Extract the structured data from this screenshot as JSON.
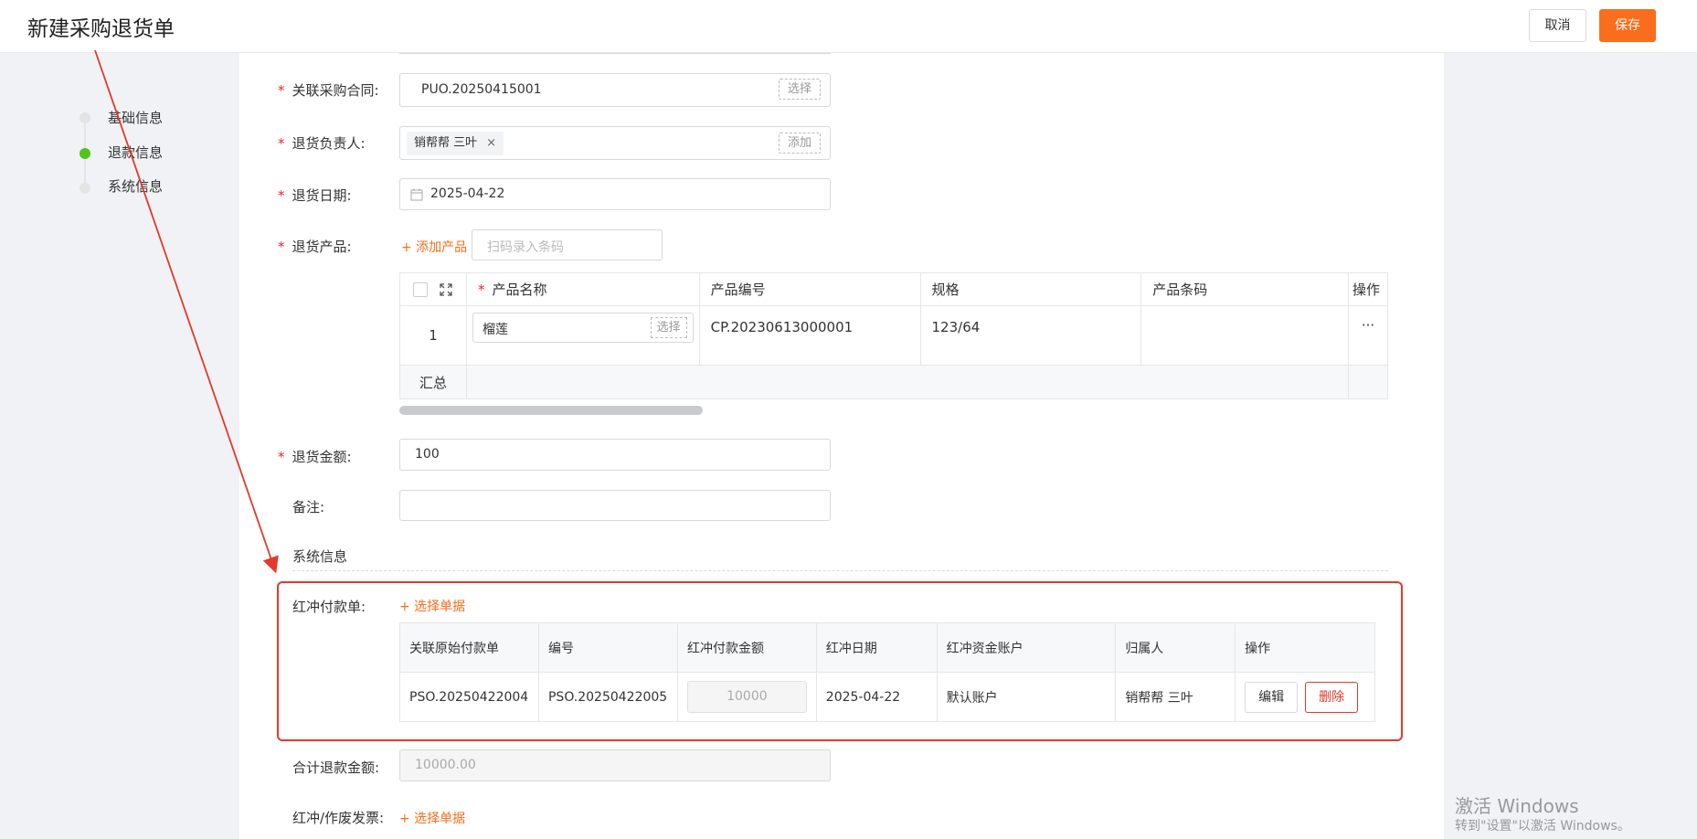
{
  "header": {
    "title": "新建采购退货单",
    "cancel_label": "取消",
    "save_label": "保存"
  },
  "steps": [
    {
      "label": "基础信息",
      "active": false
    },
    {
      "label": "退款信息",
      "active": true
    },
    {
      "label": "系统信息",
      "active": false
    }
  ],
  "form": {
    "contract": {
      "label": "关联采购合同:",
      "value": "PUO.20250415001",
      "action": "选择"
    },
    "owner": {
      "label": "退货负责人:",
      "tag": "销帮帮 三叶",
      "tag_close": "×",
      "action": "添加"
    },
    "date": {
      "label": "退货日期:",
      "value": "2025-04-22"
    },
    "products": {
      "label": "退货产品:",
      "add_label": "+ 添加产品",
      "scan_placeholder": "扫码录入条码",
      "columns": [
        "产品名称",
        "产品编号",
        "规格",
        "产品条码",
        "操作"
      ],
      "rows": [
        {
          "index": "1",
          "name": "榴莲",
          "select": "选择",
          "code": "CP.20230613000001",
          "spec": "123/64",
          "barcode": "",
          "more": "···"
        }
      ],
      "summary_label": "汇总"
    },
    "amount": {
      "label": "退货金额:",
      "value": "100"
    },
    "remark": {
      "label": "备注:",
      "value": ""
    },
    "system_section": "系统信息",
    "redpay": {
      "label": "红冲付款单:",
      "select_label": "+ 选择单据",
      "columns": [
        "关联原始付款单",
        "编号",
        "红冲付款金额",
        "红冲日期",
        "红冲资金账户",
        "归属人",
        "操作"
      ],
      "rows": [
        {
          "origin": "PSO.20250422004",
          "number": "PSO.20250422005",
          "amount": "10000",
          "date": "2025-04-22",
          "account": "默认账户",
          "owner": "销帮帮 三叶",
          "edit": "编辑",
          "delete": "删除"
        }
      ]
    },
    "total": {
      "label": "合计退款金额:",
      "value": "10000.00"
    },
    "invoice": {
      "label": "红冲/作废发票:",
      "select_label": "+ 选择单据"
    }
  },
  "watermark": {
    "line1": "激活 Windows",
    "line2": "转到\"设置\"以激活 Windows。"
  }
}
